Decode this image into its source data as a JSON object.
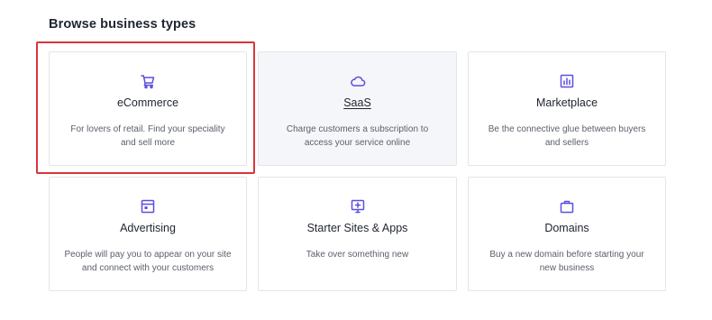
{
  "section": {
    "heading": "Browse business types"
  },
  "cards": [
    {
      "title": "eCommerce",
      "icon": "shopping-cart-icon",
      "description": "For lovers of retail. Find your speciality and sell more"
    },
    {
      "title": "SaaS",
      "icon": "cloud-icon",
      "description": "Charge customers a subscription to access your service online"
    },
    {
      "title": "Marketplace",
      "icon": "bar-chart-icon",
      "description": "Be the connective glue between buyers and sellers"
    },
    {
      "title": "Advertising",
      "icon": "browser-window-icon",
      "description": "People will pay you to appear on your site and connect with your customers"
    },
    {
      "title": "Starter Sites & Apps",
      "icon": "monitor-plus-icon",
      "description": "Take over something new"
    },
    {
      "title": "Domains",
      "icon": "briefcase-icon",
      "description": "Buy a new domain before starting your new business"
    }
  ],
  "colors": {
    "accent": "#5b4fe0",
    "highlight": "#d9363a",
    "card_hover_bg": "#f5f6f9",
    "border": "#e3e5ea"
  }
}
